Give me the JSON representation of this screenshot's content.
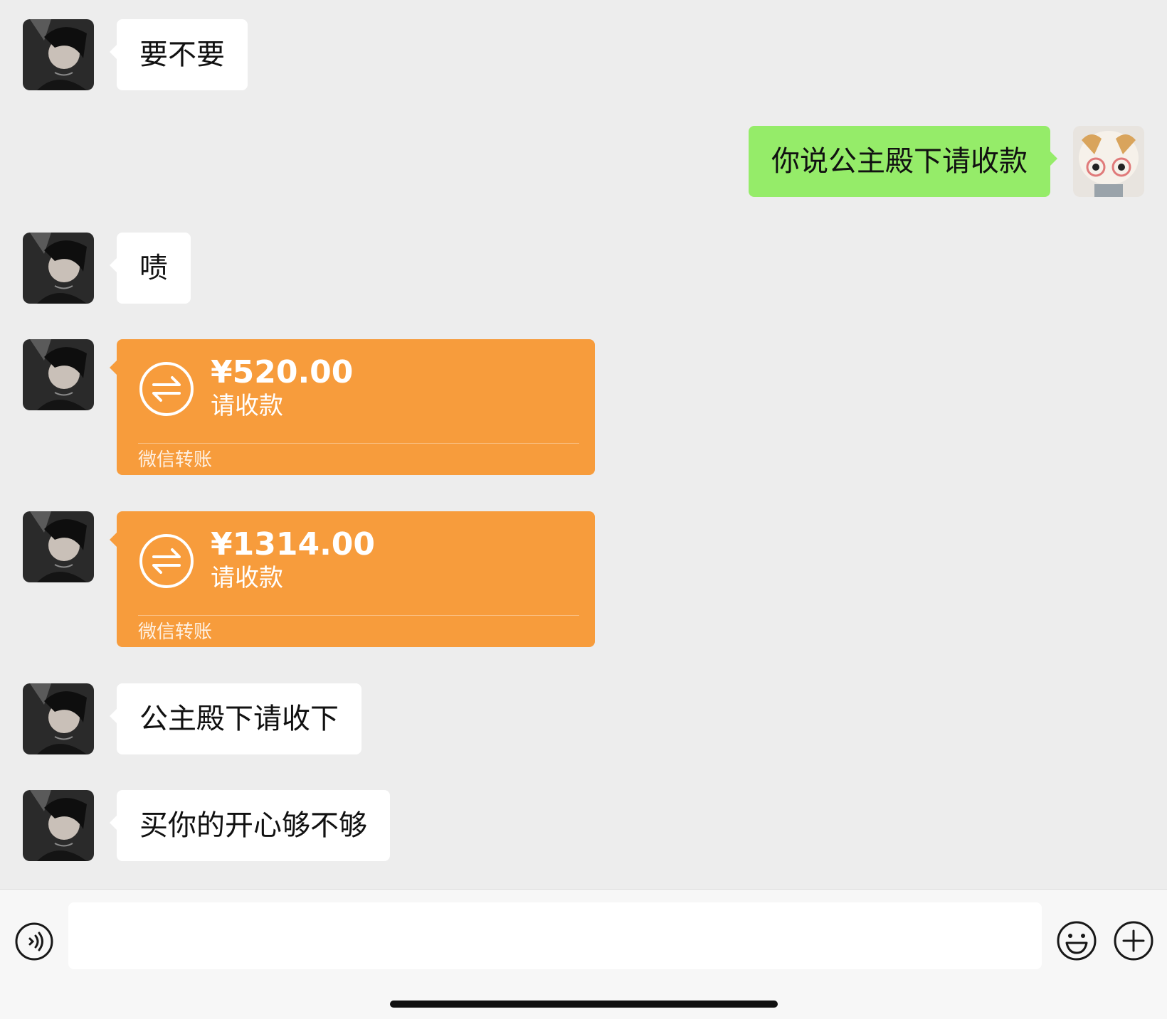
{
  "messages": [
    {
      "side": "in",
      "type": "text",
      "text": "要不要"
    },
    {
      "side": "out",
      "type": "text",
      "text": "你说公主殿下请收款"
    },
    {
      "side": "in",
      "type": "text",
      "text": "啧"
    },
    {
      "side": "in",
      "type": "transfer",
      "amount": "¥520.00",
      "note": "请收款",
      "brand": "微信转账"
    },
    {
      "side": "in",
      "type": "transfer",
      "amount": "¥1314.00",
      "note": "请收款",
      "brand": "微信转账"
    },
    {
      "side": "in",
      "type": "text",
      "text": "公主殿下请收下"
    },
    {
      "side": "in",
      "type": "text",
      "text": "买你的开心够不够"
    }
  ],
  "input": {
    "value": "",
    "placeholder": ""
  },
  "icons": {
    "voice": "voice-icon",
    "emoji": "emoji-icon",
    "plus": "plus-icon",
    "transfer": "transfer-icon"
  },
  "colors": {
    "chat_background": "#ededed",
    "incoming_bubble": "#ffffff",
    "outgoing_bubble": "#95ec69",
    "transfer_card": "#f79c3c",
    "input_bar": "#f7f7f7"
  }
}
